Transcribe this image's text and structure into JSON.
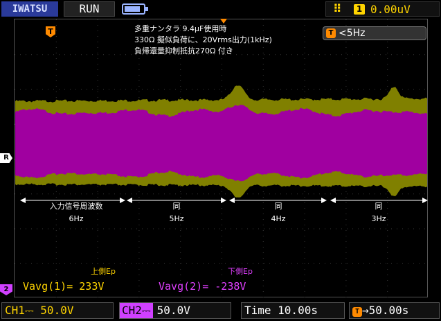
{
  "header": {
    "brand": "IWATSU",
    "run_state": "RUN",
    "battery_level": 0.85,
    "trigger_edge_icon": "rising-edge-icon",
    "trigger_channel": "1",
    "trigger_level": "0.00uV"
  },
  "markers": {
    "trigger_position_icon": "trigger-position-icon",
    "trigger_marker_label": "T",
    "reference_label": "R",
    "ch2_label": "2"
  },
  "annotation": {
    "line1": "多重ナンタラ 9.4μF使用時",
    "line2": "330Ω 擬似負荷に、20Vrms出力(1kHz)",
    "line3": "負帰還量抑制抵抗270Ω 付き"
  },
  "filter": {
    "icon_label": "T",
    "text": "<5Hz"
  },
  "segments": [
    {
      "title": "入力信号周波数",
      "freq": "6Hz"
    },
    {
      "title": "同",
      "freq": "5Hz"
    },
    {
      "title": "同",
      "freq": "4Hz"
    },
    {
      "title": "同",
      "freq": "3Hz"
    }
  ],
  "measurements": {
    "upper_label": "上側Ep",
    "lower_label": "下側Ep",
    "ch1_text": "Vavg(1)= 233V",
    "ch2_text": "Vavg(2)= -238V"
  },
  "footer": {
    "ch1": "CH1⎓  50.0V",
    "ch2_tag": "CH2⎓",
    "ch2_value": "50.0V",
    "time": "Time 10.00s",
    "delay_icon": "T",
    "delay_value": "→50.00s"
  },
  "colors": {
    "ch1": "#808000",
    "ch2": "#a000a0",
    "trigger": "#ff8a00",
    "upper_label": "#ffd400",
    "lower_label": "#e040ff"
  }
}
